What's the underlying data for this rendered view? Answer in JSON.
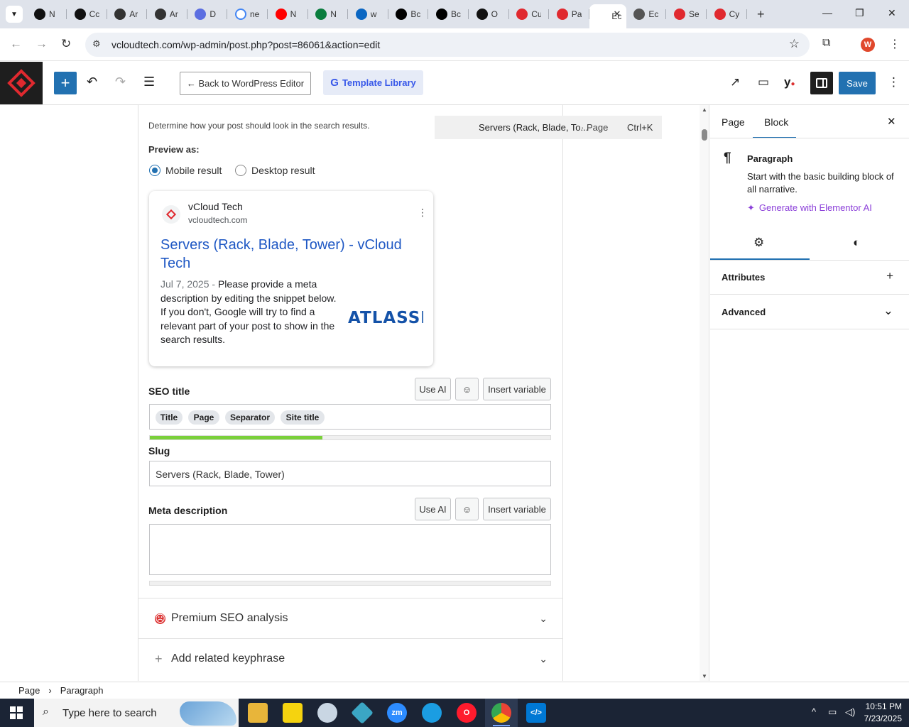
{
  "tabs": [
    {
      "label": "N",
      "icon": "threads-icon"
    },
    {
      "label": "Cc",
      "icon": "threads-icon"
    },
    {
      "label": "Ar",
      "icon": "openai-icon"
    },
    {
      "label": "Ar",
      "icon": "openai-icon"
    },
    {
      "label": "D",
      "icon": "copilot-icon"
    },
    {
      "label": "ne",
      "icon": "google-icon"
    },
    {
      "label": "N",
      "icon": "youtube-icon"
    },
    {
      "label": "N",
      "icon": "webflow-icon"
    },
    {
      "label": "w",
      "icon": "linkedin-icon"
    },
    {
      "label": "Bc",
      "icon": "x-icon"
    },
    {
      "label": "Bc",
      "icon": "x-icon"
    },
    {
      "label": "O",
      "icon": "perplexity-icon"
    },
    {
      "label": "Cu",
      "icon": "vcloud-icon"
    },
    {
      "label": "Pa",
      "icon": "vcloud-icon"
    },
    {
      "label": "Ec",
      "icon": "active"
    },
    {
      "label": "Ec",
      "icon": "globe-icon"
    },
    {
      "label": "Se",
      "icon": "vcloud-icon"
    },
    {
      "label": "Cy",
      "icon": "vcloud-icon"
    }
  ],
  "browser": {
    "url": "vcloudtech.com/wp-admin/post.php?post=86061&action=edit",
    "avatar_letter": "W"
  },
  "toolbar": {
    "back_label": "← Back to WordPress Editor",
    "template_label": "Template Library",
    "save_label": "Save"
  },
  "command_tip": {
    "title": "Servers (Rack, Blade, To...",
    "type": "· Page",
    "shortcut": "Ctrl+K"
  },
  "seo": {
    "description": "Determine how your post should look in the search results.",
    "preview_label": "Preview as:",
    "mobile_label": "Mobile result",
    "desktop_label": "Desktop result",
    "preview": {
      "site_name": "vCloud Tech",
      "host": "vcloudtech.com",
      "title": "Servers (Rack, Blade, Tower) - vCloud Tech",
      "date": "Jul 7, 2025",
      "separator": " - ",
      "snippet": "Please provide a meta description by editing the snippet below. If you don't, Google will try to find a relevant part of your post to show in the search results.",
      "thumbnail_text": "ATLASSIAN"
    },
    "seo_title_label": "SEO title",
    "use_ai_label": "Use AI",
    "insert_variable_label": "Insert variable",
    "title_pills": [
      "Title",
      "Page",
      "Separator",
      "Site title"
    ],
    "title_progress": 0.43,
    "slug_label": "Slug",
    "slug_value": "Servers (Rack, Blade, Tower)",
    "meta_label": "Meta description",
    "meta_value": "",
    "meta_progress": 0,
    "premium_label": "Premium SEO analysis",
    "related_label": "Add related keyphrase"
  },
  "sidebar": {
    "tab_page": "Page",
    "tab_block": "Block",
    "block_name": "Paragraph",
    "block_desc": "Start with the basic building block of all narrative.",
    "generate_label": "Generate with Elementor AI",
    "attributes_label": "Attributes",
    "advanced_label": "Advanced"
  },
  "breadcrumb": {
    "root": "Page",
    "current": "Paragraph"
  },
  "taskbar": {
    "search_placeholder": "Type here to search",
    "time": "10:51 PM",
    "date": "7/23/2025"
  },
  "colors": {
    "accent": "#2271b1",
    "progress_good": "#7ad03a",
    "link": "#1f58c4",
    "brand_red": "#e0292f"
  }
}
